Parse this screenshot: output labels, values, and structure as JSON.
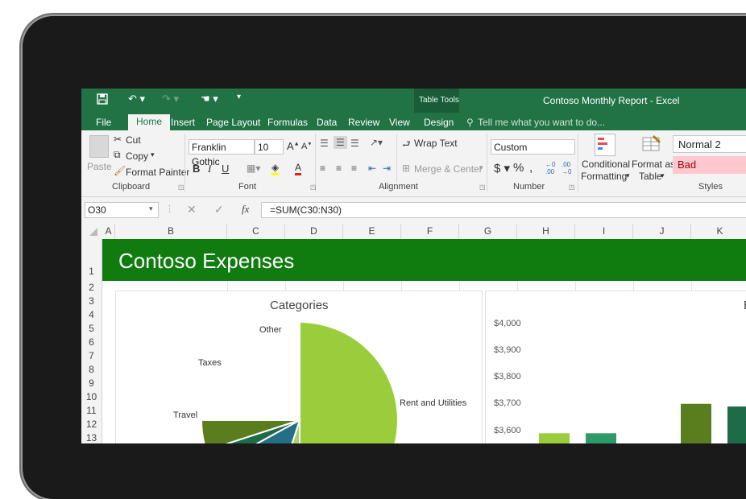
{
  "window": {
    "title": "Contoso Monthly Report - Excel",
    "contextual_tab_group": "Table Tools",
    "tell_me_placeholder": "Tell me what you want to do..."
  },
  "ribbon_tabs": [
    "File",
    "Home",
    "Insert",
    "Page Layout",
    "Formulas",
    "Data",
    "Review",
    "View",
    "Design"
  ],
  "active_tab": "Home",
  "clipboard": {
    "paste": "Paste",
    "cut": "Cut",
    "copy": "Copy",
    "format_painter": "Format Painter",
    "label": "Clipboard"
  },
  "font": {
    "family": "Franklin Gothic",
    "size": "10",
    "label": "Font"
  },
  "alignment": {
    "wrap_text": "Wrap Text",
    "merge_center": "Merge & Center",
    "label": "Alignment"
  },
  "number": {
    "format": "Custom",
    "label": "Number"
  },
  "styles": {
    "conditional_formatting": [
      "Conditional",
      "Formatting"
    ],
    "format_as_table": [
      "Format as",
      "Table"
    ],
    "cell_styles": [
      "Normal 2",
      "Bad"
    ],
    "label": "Styles"
  },
  "formula_bar": {
    "name_box": "O30",
    "formula": "=SUM(C30:N30)",
    "fx": "fx"
  },
  "columns": [
    "A",
    "B",
    "C",
    "D",
    "E",
    "F",
    "G",
    "H",
    "I",
    "J",
    "K"
  ],
  "rows": [
    "1",
    "2",
    "3",
    "4",
    "5",
    "6",
    "7",
    "8",
    "9",
    "10",
    "11",
    "12",
    "13"
  ],
  "sheet_title": "Contoso Expenses",
  "colors": {
    "excel_green": "#217346",
    "band_green": "#107c10",
    "bad_fill": "#ffc7ce",
    "bad_text": "#9c0006"
  },
  "chart_data": [
    {
      "type": "pie",
      "title": "Categories",
      "labels": [
        "Rent and Utilities",
        "Other",
        "Taxes",
        "Travel"
      ],
      "slices": [
        {
          "label": "Rent and Utilities",
          "value": 0.5,
          "color": "#9acd3c"
        },
        {
          "label": "Other",
          "value": 0.05,
          "color": "#a9d468"
        },
        {
          "label": "Taxes",
          "value": 0.12,
          "color": "#256f86"
        },
        {
          "label": "Travel",
          "value": 0.03,
          "color": "#1e6b47"
        },
        {
          "label": "",
          "value": 0.05,
          "color": "#5a7d1e"
        }
      ]
    },
    {
      "type": "bar",
      "title": "",
      "y_ticks": [
        "$4,000",
        "$3,900",
        "$3,800",
        "$3,700",
        "$3,600"
      ],
      "ylim": [
        3600,
        4000
      ],
      "values": [
        3590,
        3590,
        3700,
        3690
      ],
      "colors": [
        "#9acd3c",
        "#2e9a6a",
        "#5a7d1e",
        "#1e6b47"
      ]
    }
  ]
}
